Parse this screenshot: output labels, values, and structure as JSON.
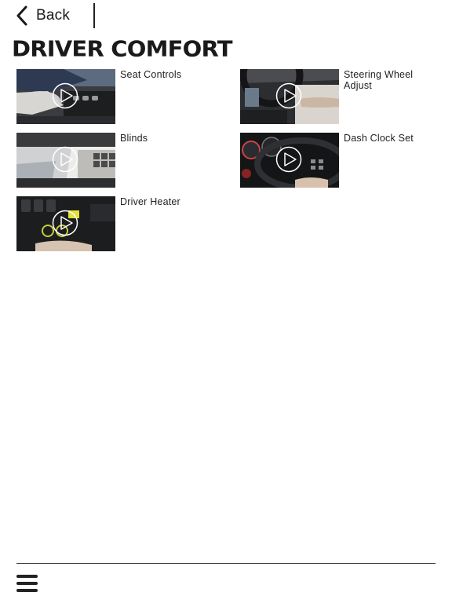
{
  "header": {
    "back_label": "Back"
  },
  "page": {
    "title": "DRIVER COMFORT"
  },
  "videos": [
    {
      "label": "Seat Controls"
    },
    {
      "label": "Steering Wheel Adjust"
    },
    {
      "label": "Blinds"
    },
    {
      "label": "Dash Clock Set"
    },
    {
      "label": "Driver Heater"
    }
  ],
  "footer": {
    "menu_icon": "hamburger-menu-icon"
  }
}
